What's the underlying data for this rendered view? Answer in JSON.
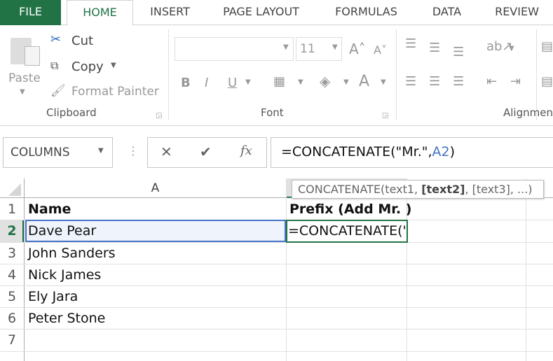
{
  "tabs": [
    "FILE",
    "HOME",
    "INSERT",
    "PAGE LAYOUT",
    "FORMULAS",
    "DATA",
    "REVIEW"
  ],
  "clipboard": {
    "paste": "Paste",
    "cut": "Cut",
    "copy": "Copy",
    "format_painter": "Format Painter",
    "group": "Clipboard"
  },
  "font": {
    "name": "",
    "size": "11",
    "group": "Font"
  },
  "alignment": {
    "group": "Alignment"
  },
  "name_box": "COLUMNS",
  "formula": {
    "prefix": "=CONCATENATE(\"Mr.\",",
    "ref": "A2",
    "suffix": ")"
  },
  "tooltip": {
    "fn": "CONCATENATE(text1, ",
    "arg_bold": "[text2]",
    "rest": ", [text3], ...)"
  },
  "columns": [
    "A"
  ],
  "rows": [
    "1",
    "2",
    "3",
    "4",
    "5",
    "6",
    "7"
  ],
  "cells": {
    "A": [
      "Name",
      "Dave Pear",
      "John Sanders",
      "Nick James",
      "Ely Jara",
      "Peter Stone",
      ""
    ],
    "B1": "Prefix (Add Mr. )",
    "B2": "=CONCATENATE('"
  },
  "colors": {
    "accent": "#217346",
    "ref": "#4472c4"
  }
}
